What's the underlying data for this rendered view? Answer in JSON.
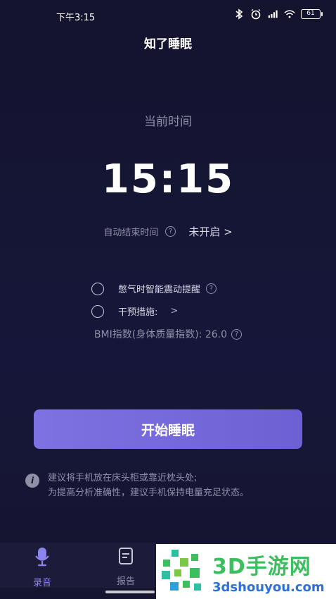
{
  "status_bar": {
    "time": "下午3:15",
    "battery": "61"
  },
  "header": {
    "title": "知了睡眠"
  },
  "main": {
    "current_time_label": "当前时间",
    "clock": "15:15",
    "auto_end_label": "自动结束时间",
    "auto_end_value": "未开启 >",
    "options": [
      {
        "label": "憋气时智能震动提醒"
      },
      {
        "label": "干预措施:"
      }
    ],
    "bmi_text": "BMI指数(身体质量指数): 26.0",
    "start_button": "开始睡眠",
    "tips": [
      "建议将手机放在床头柜或靠近枕头处;",
      "为提高分析准确性，建议手机保持电量充足状态。"
    ]
  },
  "tab_bar": {
    "tabs": [
      {
        "label": "录音",
        "icon": "microphone-icon",
        "active": true
      },
      {
        "label": "报告",
        "icon": "report-icon",
        "active": false
      }
    ]
  },
  "watermark": {
    "name": "3D手游网",
    "url": "3dshouyou.com"
  },
  "colors": {
    "background": "#14142c",
    "accent": "#7e72e2",
    "muted_text": "#8f90a8",
    "watermark_green": "#3bbf5f",
    "watermark_blue": "#2e6fd8"
  }
}
